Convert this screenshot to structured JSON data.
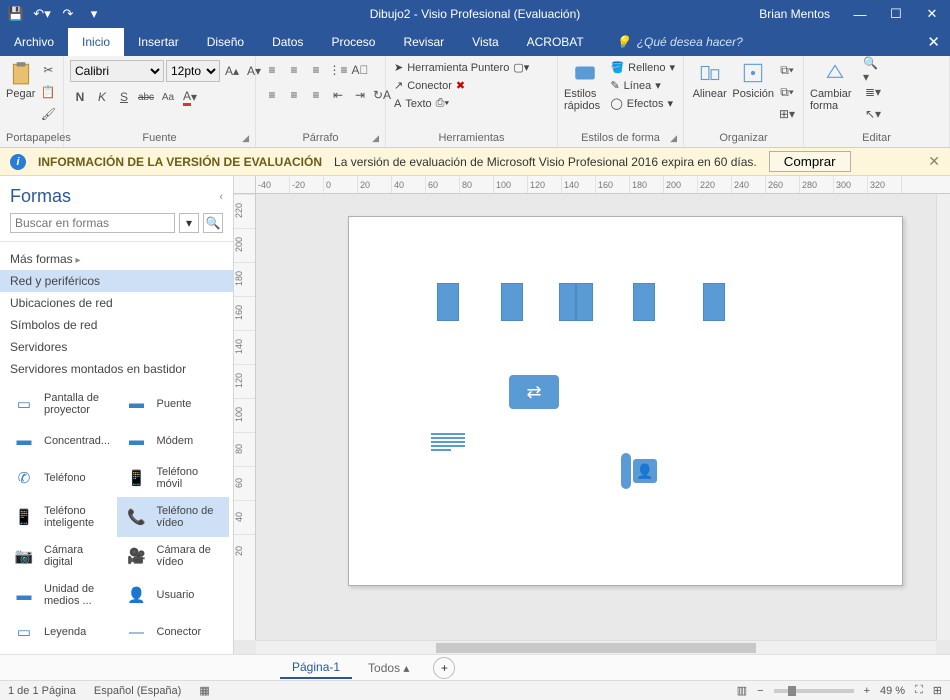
{
  "title": "Dibujo2 - Visio Profesional (Evaluación)",
  "user": "Brian Mentos",
  "tabs": {
    "file": "Archivo",
    "home": "Inicio",
    "insert": "Insertar",
    "design": "Diseño",
    "data": "Datos",
    "process": "Proceso",
    "review": "Revisar",
    "view": "Vista",
    "acrobat": "ACROBAT"
  },
  "tellme": {
    "icon": "💡",
    "placeholder": "¿Qué desea hacer?"
  },
  "ribbon": {
    "clipboard": {
      "label": "Portapapeles",
      "paste": "Pegar"
    },
    "font": {
      "label": "Fuente",
      "name": "Calibri",
      "size": "12pto",
      "btns": {
        "bold": "N",
        "italic": "K",
        "underline": "S",
        "strike": "abc",
        "case": "Aa"
      }
    },
    "paragraph": {
      "label": "Párrafo"
    },
    "tools": {
      "label": "Herramientas",
      "pointer": "Herramienta Puntero",
      "connector": "Conector",
      "text": "Texto"
    },
    "shapestyle": {
      "label": "Estilos de forma",
      "quick": "Estilos rápidos",
      "fill": "Relleno",
      "line": "Línea",
      "effects": "Efectos"
    },
    "arrange": {
      "label": "Organizar",
      "align": "Alinear",
      "position": "Posición"
    },
    "edit": {
      "label": "Editar",
      "change": "Cambiar forma"
    }
  },
  "trial": {
    "bold": "INFORMACIÓN DE LA VERSIÓN DE EVALUACIÓN",
    "text": "La versión de evaluación de Microsoft Visio Profesional 2016 expira en 60 días.",
    "buy": "Comprar"
  },
  "shapes_panel": {
    "title": "Formas",
    "search_placeholder": "Buscar en formas",
    "more": "Más formas",
    "cats": [
      "Red y periféricos",
      "Ubicaciones de red",
      "Símbolos de red",
      "Servidores",
      "Servidores montados en bastidor"
    ],
    "stencil": [
      {
        "n": "Pantalla de proyector",
        "i": "▭"
      },
      {
        "n": "Puente",
        "i": "▬"
      },
      {
        "n": "Concentrad...",
        "i": "▬"
      },
      {
        "n": "Módem",
        "i": "▬"
      },
      {
        "n": "Teléfono",
        "i": "✆"
      },
      {
        "n": "Teléfono móvil",
        "i": "📱"
      },
      {
        "n": "Teléfono inteligente",
        "i": "📱"
      },
      {
        "n": "Teléfono de vídeo",
        "i": "📞",
        "sel": true
      },
      {
        "n": "Cámara digital",
        "i": "📷"
      },
      {
        "n": "Cámara de vídeo",
        "i": "🎥"
      },
      {
        "n": "Unidad de medios ...",
        "i": "▬"
      },
      {
        "n": "Usuario",
        "i": "👤"
      },
      {
        "n": "Leyenda",
        "i": "▭"
      },
      {
        "n": "Conector",
        "i": "—"
      }
    ]
  },
  "ruler_h": [
    "-40",
    "-20",
    "0",
    "20",
    "40",
    "60",
    "80",
    "100",
    "120",
    "140",
    "160",
    "180",
    "200",
    "220",
    "240",
    "260",
    "280",
    "300",
    "320"
  ],
  "ruler_v": [
    "220",
    "200",
    "180",
    "160",
    "140",
    "120",
    "100",
    "80",
    "60",
    "40",
    "20"
  ],
  "pagetabs": {
    "page1": "Página-1",
    "all": "Todos"
  },
  "status": {
    "pages": "1 de 1 Página",
    "lang": "Español (España)",
    "zoom": "49 %"
  }
}
